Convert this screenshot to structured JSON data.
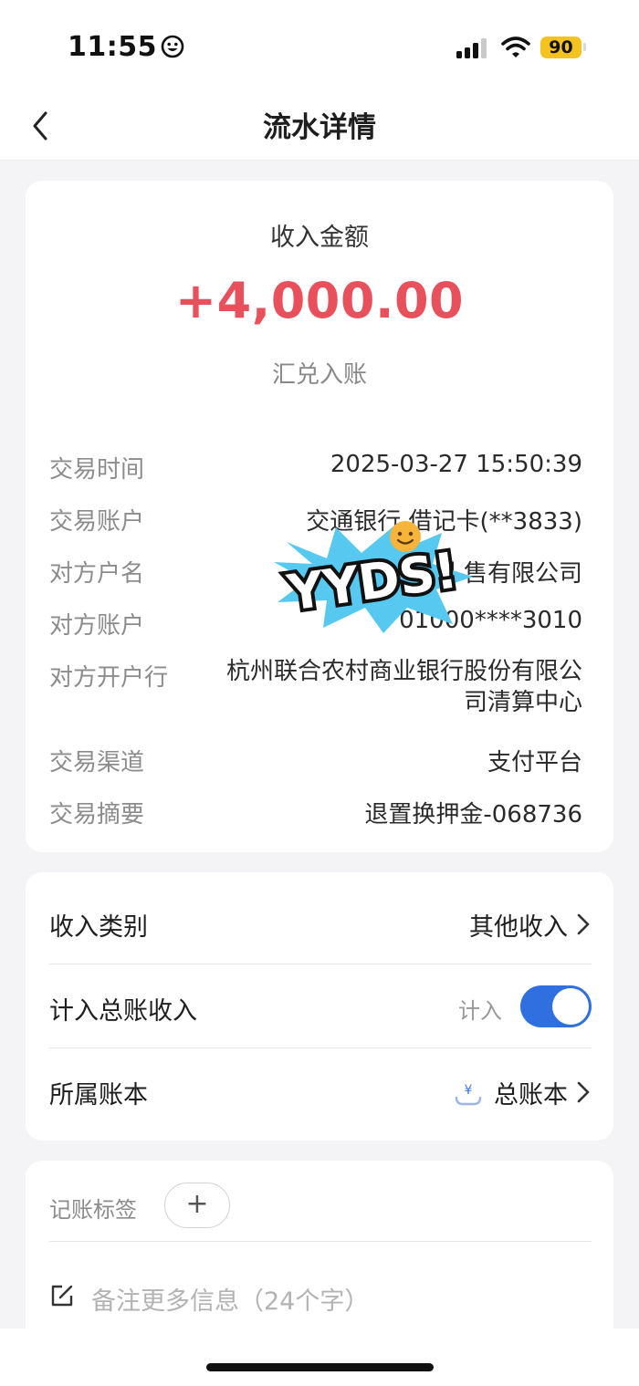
{
  "status_bar": {
    "time": "11:55",
    "battery": "90",
    "colors": {
      "battery": "#f5c31f"
    }
  },
  "header": {
    "title": "流水详情",
    "back_icon": "chevron-left-icon"
  },
  "amount_card": {
    "label": "收入金额",
    "amount": "+4,000.00",
    "subtitle": "汇兑入账",
    "colors": {
      "amount": "#e8505b"
    }
  },
  "details": [
    {
      "key": "交易时间",
      "value": "2025-03-27 15:50:39"
    },
    {
      "key": "交易账户",
      "value": "交通银行 借记卡(**3833)"
    },
    {
      "key": "对方户名",
      "value": "杭州 售有限公司"
    },
    {
      "key": "对方账户",
      "value": "01000****3010"
    },
    {
      "key": "对方开户行",
      "value": "杭州联合农村商业银行股份有限公司清算中心"
    },
    {
      "key": "交易渠道",
      "value": "支付平台"
    },
    {
      "key": "交易摘要",
      "value": "退置换押金-068736"
    }
  ],
  "sticker": {
    "text": "YYDS!"
  },
  "settings": {
    "category": {
      "label": "收入类别",
      "value": "其他收入"
    },
    "ledger_income": {
      "label": "计入总账收入",
      "toggle_label": "计入",
      "enabled": true,
      "colors": {
        "on": "#2f6fe0"
      }
    },
    "book": {
      "label": "所属账本",
      "value": "总账本"
    }
  },
  "tags": {
    "label": "记账标签",
    "add": "+"
  },
  "note": {
    "placeholder": "备注更多信息（24个字）"
  }
}
